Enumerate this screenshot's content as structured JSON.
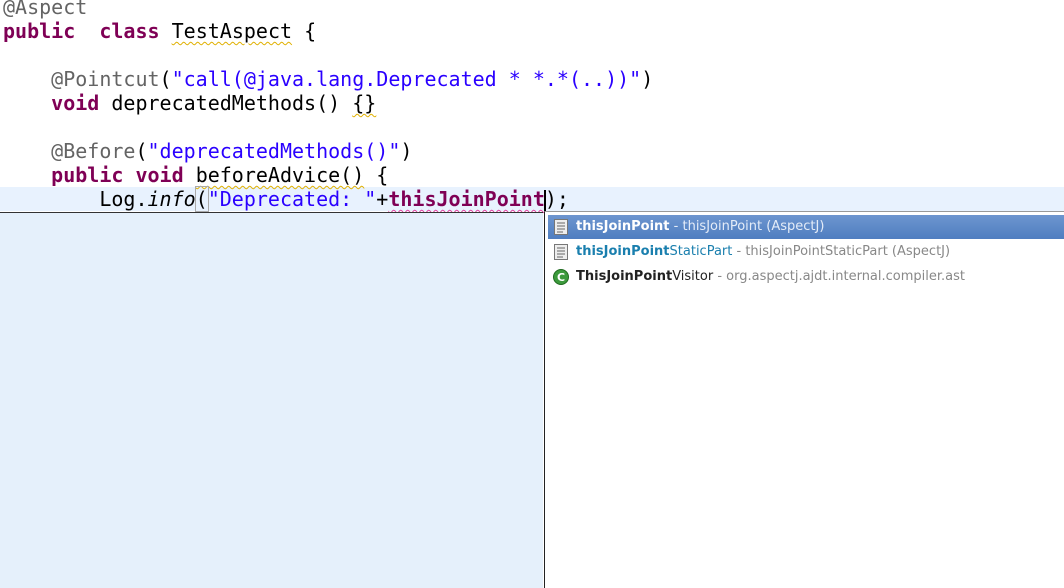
{
  "code": {
    "l1": "@Aspect",
    "l2": {
      "kw1": "public",
      "kw2": "class",
      "name": "TestAspect",
      "rest": " {"
    },
    "l4": {
      "ann": "@Pointcut",
      "p1": "(",
      "str": "\"call(@java.lang.Deprecated * *.*(..))\"",
      "p2": ")"
    },
    "l5": {
      "kw": "void",
      "name": " deprecatedMethods() ",
      "braces": "{}"
    },
    "l7": {
      "ann": "@Before",
      "p1": "(",
      "str": "\"deprecatedMethods()\"",
      "p2": ")"
    },
    "l8": {
      "kw1": "public",
      "kw2": "void",
      "name": "beforeAdvice()",
      "rest": " {"
    },
    "l9": {
      "obj": "Log.",
      "method": "info",
      "p1": "(",
      "str": "\"Deprecated: \"",
      "plus": "+",
      "field": "thisJoinPoint",
      "end": ");"
    }
  },
  "completions": [
    {
      "match": "thisJoinPoint",
      "rest": "",
      "desc": " - thisJoinPoint (AspectJ)",
      "icon": "field-doc-icon",
      "selected": true
    },
    {
      "match": "thisJoinPoint",
      "rest": "StaticPart",
      "desc": " - thisJoinPointStaticPart (AspectJ)",
      "icon": "field-doc-icon"
    },
    {
      "match": "ThisJoinPoint",
      "rest": "Visitor",
      "desc": " - org.aspectj.ajdt.internal.compiler.ast",
      "icon": "class-icon"
    }
  ]
}
